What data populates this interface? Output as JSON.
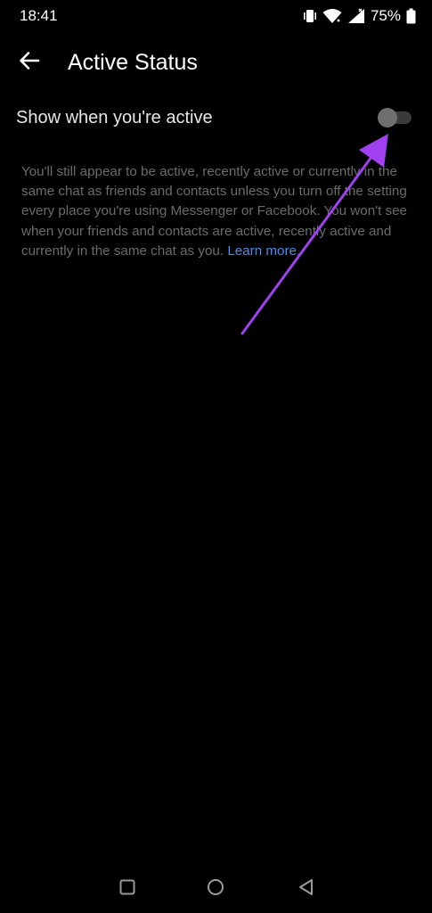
{
  "status_bar": {
    "time": "18:41",
    "battery_percent": "75%",
    "icons": [
      "vibrate-icon",
      "wifi-icon",
      "signal-icon",
      "battery-icon"
    ]
  },
  "header": {
    "title": "Active Status",
    "back_icon": "back-arrow-icon"
  },
  "setting": {
    "label": "Show when you're active",
    "toggle_on": false
  },
  "description": {
    "text": "You'll still appear to be active, recently active or currently in the same chat as friends and contacts unless you turn off the setting every place you're using Messenger or Facebook. You won't see when your friends and contacts are active, recently active and currently in the same chat as you. ",
    "link_text": "Learn more."
  },
  "colors": {
    "background": "#000000",
    "link": "#4a8cf0",
    "annotation_arrow": "#a040f0"
  },
  "nav_bar": {
    "buttons": [
      "recents-square-icon",
      "home-circle-icon",
      "back-triangle-icon"
    ]
  }
}
